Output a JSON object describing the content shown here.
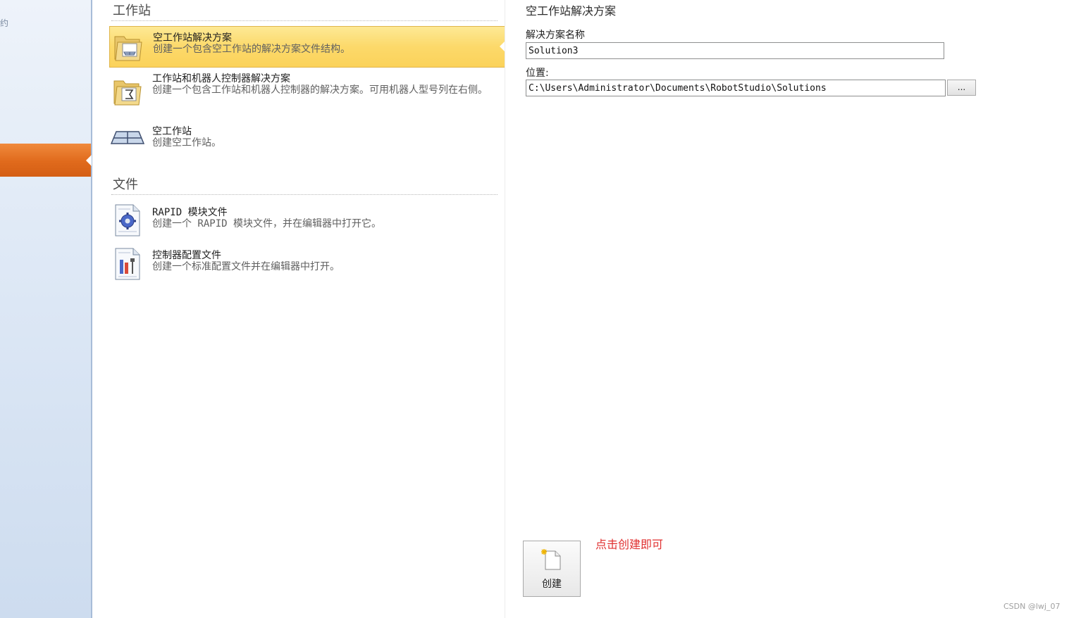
{
  "sidebar": {
    "stub_text": "约",
    "colors": {
      "active": "#e06a1c",
      "background": "#dfe9f6"
    }
  },
  "sections": {
    "workstation": {
      "title": "工作站",
      "items": [
        {
          "title": "空工作站解决方案",
          "desc": "创建一个包含空工作站的解决方案文件结构。",
          "icon": "solution-folder-icon",
          "selected": true
        },
        {
          "title": "工作站和机器人控制器解决方案",
          "desc": "创建一个包含工作站和机器人控制器的解决方案。可用机器人型号列在右侧。",
          "icon": "robot-solution-folder-icon",
          "selected": false
        },
        {
          "title": "空工作站",
          "desc": "创建空工作站。",
          "icon": "station-floor-icon",
          "selected": false
        }
      ]
    },
    "files": {
      "title": "文件",
      "items": [
        {
          "title": "RAPID 模块文件",
          "desc": "创建一个 RAPID 模块文件，并在编辑器中打开它。",
          "icon": "rapid-module-file-icon"
        },
        {
          "title": "控制器配置文件",
          "desc": "创建一个标准配置文件并在编辑器中打开。",
          "icon": "controller-config-file-icon"
        }
      ]
    }
  },
  "panel": {
    "title": "空工作站解决方案",
    "name_label": "解决方案名称",
    "name_value": "Solution3",
    "location_label": "位置:",
    "location_value": "C:\\Users\\Administrator\\Documents\\RobotStudio\\Solutions",
    "browse_label": "...",
    "create_label": "创建",
    "create_icon": "new-document-icon"
  },
  "annotation": {
    "hint": "点击创建即可",
    "hint_color": "#e03030"
  },
  "watermark": "CSDN @lwj_07",
  "colors": {
    "selected_item": "#fcd96a"
  }
}
